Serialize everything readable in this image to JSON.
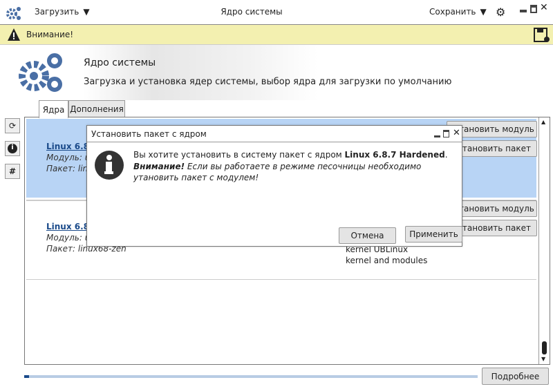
{
  "titlebar": {
    "load": "Загрузить",
    "title": "Ядро системы",
    "save": "Сохранить"
  },
  "warning": {
    "text": "Внимание!"
  },
  "header": {
    "title": "Ядро системы",
    "subtitle": "Загрузка и установка ядер системы, выбор ядра для загрузки по умолчанию"
  },
  "tabs": [
    {
      "label": "Ядра"
    },
    {
      "label": "Дополнения"
    }
  ],
  "kernels": [
    {
      "name": "Linux 6.8.",
      "module": "Модуль: u",
      "package": "Пакет: linu",
      "install_module": "Установить модуль",
      "install_package": "Установить пакет",
      "selected": true
    },
    {
      "name": "Linux 6.8.",
      "module": "Модуль: u",
      "package": "Пакет: linux68-zen",
      "description": "kernel UBLinux kernel and modules",
      "install_module": "Установить модуль",
      "install_package": "Установить пакет",
      "selected": false
    }
  ],
  "dialog": {
    "title": "Установить пакет с ядром",
    "line1": "Вы хотите установить в систему пакет с ядром ",
    "kernel": "Linux 6.8.7 Hardened",
    "line1_end": ".",
    "warn_bold": "Внимание!",
    "warn_text": " Если вы работаете в режиме песочницы необходимо утановить пакет с модулем!",
    "cancel": "Отмена",
    "apply": "Применить"
  },
  "footer": {
    "progress": 0.01,
    "details": "Подробнее"
  }
}
